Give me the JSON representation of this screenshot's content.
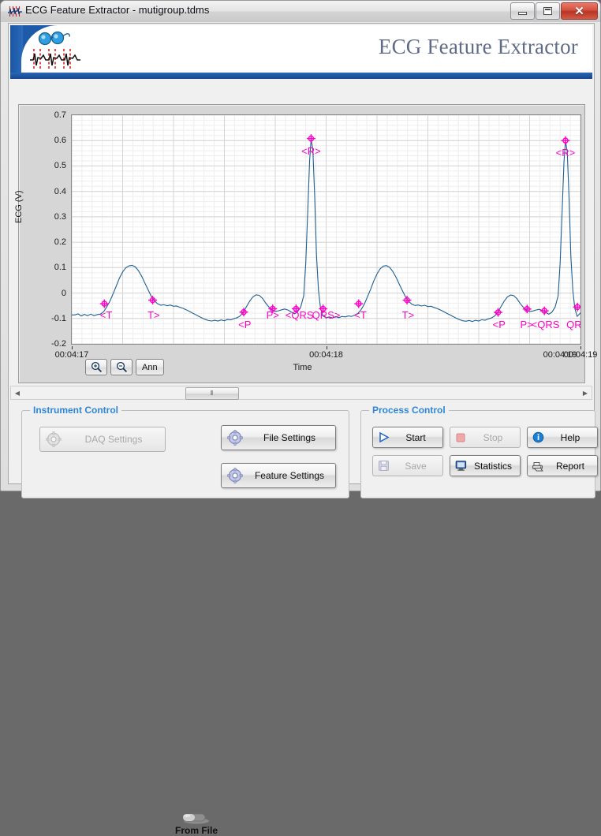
{
  "window": {
    "title": "ECG Feature Extractor - mutigroup.tdms",
    "icon": "ecg-waveform-icon",
    "buttons": {
      "minimize": "minimize-icon",
      "maximize": "maximize-icon",
      "close": "close-icon",
      "close_glyph": "✕"
    }
  },
  "banner": {
    "title": "ECG Feature Extractor",
    "logo": "ecg-glasses-logo"
  },
  "graph": {
    "y_axis_label": "ECG (V)",
    "x_axis_label": "Time",
    "y_ticks": [
      "0.7",
      "0.6",
      "0.5",
      "0.4",
      "0.3",
      "0.2",
      "0.1",
      "0",
      "-0.1",
      "-0.2"
    ],
    "x_ticks": [
      "00:04:17",
      "00:04:18",
      "00:04:19",
      "00:04:19"
    ],
    "buttons": [
      {
        "name": "zoom-in-button",
        "label": "",
        "icon": "zoom-in-icon"
      },
      {
        "name": "zoom-out-button",
        "label": "",
        "icon": "zoom-out-icon"
      },
      {
        "name": "annotation-button",
        "label": "Ann",
        "icon": ""
      }
    ]
  },
  "chart_data": {
    "type": "line",
    "title": "",
    "xlabel": "Time",
    "ylabel": "ECG (V)",
    "ylim": [
      -0.2,
      0.7
    ],
    "xlim": [
      0,
      2.0
    ],
    "x_tick_values": [
      0.0,
      1.0,
      2.0,
      2.0
    ],
    "x_tick_labels": [
      "00:04:17",
      "00:04:18",
      "00:04:19",
      "00:04:19"
    ],
    "grid": true,
    "legend": "none",
    "series_color": "#1f5f91",
    "annotation_color": "#ff00c8",
    "baseline": -0.085,
    "series": [
      {
        "name": "ECG",
        "points": [
          [
            0.0,
            -0.086
          ],
          [
            0.012,
            -0.086
          ],
          [
            0.025,
            -0.082
          ],
          [
            0.037,
            -0.09
          ],
          [
            0.05,
            -0.084
          ],
          [
            0.062,
            -0.089
          ],
          [
            0.075,
            -0.083
          ],
          [
            0.087,
            -0.089
          ],
          [
            0.1,
            -0.085
          ],
          [
            0.112,
            -0.083
          ],
          [
            0.125,
            -0.074
          ],
          [
            0.137,
            -0.055
          ],
          [
            0.15,
            -0.032
          ],
          [
            0.162,
            -0.004
          ],
          [
            0.175,
            0.028
          ],
          [
            0.187,
            0.058
          ],
          [
            0.2,
            0.083
          ],
          [
            0.212,
            0.099
          ],
          [
            0.225,
            0.107
          ],
          [
            0.237,
            0.109
          ],
          [
            0.25,
            0.103
          ],
          [
            0.262,
            0.088
          ],
          [
            0.275,
            0.066
          ],
          [
            0.287,
            0.04
          ],
          [
            0.3,
            0.013
          ],
          [
            0.312,
            -0.012
          ],
          [
            0.325,
            -0.03
          ],
          [
            0.337,
            -0.042
          ],
          [
            0.35,
            -0.048
          ],
          [
            0.362,
            -0.046
          ],
          [
            0.375,
            -0.05
          ],
          [
            0.387,
            -0.047
          ],
          [
            0.4,
            -0.052
          ],
          [
            0.412,
            -0.051
          ],
          [
            0.425,
            -0.056
          ],
          [
            0.437,
            -0.06
          ],
          [
            0.45,
            -0.066
          ],
          [
            0.462,
            -0.072
          ],
          [
            0.475,
            -0.079
          ],
          [
            0.487,
            -0.085
          ],
          [
            0.5,
            -0.092
          ],
          [
            0.512,
            -0.098
          ],
          [
            0.525,
            -0.104
          ],
          [
            0.537,
            -0.108
          ],
          [
            0.55,
            -0.11
          ],
          [
            0.562,
            -0.107
          ],
          [
            0.575,
            -0.11
          ],
          [
            0.587,
            -0.106
          ],
          [
            0.6,
            -0.109
          ],
          [
            0.612,
            -0.104
          ],
          [
            0.625,
            -0.106
          ],
          [
            0.637,
            -0.101
          ],
          [
            0.65,
            -0.097
          ],
          [
            0.662,
            -0.09
          ],
          [
            0.675,
            -0.075
          ],
          [
            0.687,
            -0.053
          ],
          [
            0.7,
            -0.031
          ],
          [
            0.712,
            -0.015
          ],
          [
            0.725,
            -0.007
          ],
          [
            0.737,
            -0.009
          ],
          [
            0.75,
            -0.021
          ],
          [
            0.762,
            -0.039
          ],
          [
            0.775,
            -0.055
          ],
          [
            0.787,
            -0.066
          ],
          [
            0.8,
            -0.072
          ],
          [
            0.812,
            -0.07
          ],
          [
            0.825,
            -0.066
          ],
          [
            0.837,
            -0.063
          ],
          [
            0.85,
            -0.067
          ],
          [
            0.862,
            -0.074
          ],
          [
            0.875,
            -0.082
          ],
          [
            0.887,
            -0.075
          ],
          [
            0.9,
            -0.055
          ],
          [
            0.912,
            -0.01
          ],
          [
            0.92,
            0.12
          ],
          [
            0.928,
            0.33
          ],
          [
            0.935,
            0.52
          ],
          [
            0.941,
            0.608
          ],
          [
            0.948,
            0.56
          ],
          [
            0.955,
            0.38
          ],
          [
            0.962,
            0.15
          ],
          [
            0.97,
            0.01
          ],
          [
            0.978,
            -0.06
          ],
          [
            0.987,
            -0.09
          ],
          [
            1.0,
            -0.097
          ],
          [
            1.012,
            -0.094
          ],
          [
            1.025,
            -0.098
          ],
          [
            1.037,
            -0.093
          ],
          [
            1.05,
            -0.097
          ],
          [
            1.062,
            -0.092
          ],
          [
            1.075,
            -0.094
          ],
          [
            1.087,
            -0.09
          ],
          [
            1.1,
            -0.092
          ],
          [
            1.112,
            -0.087
          ],
          [
            1.125,
            -0.08
          ],
          [
            1.137,
            -0.066
          ],
          [
            1.15,
            -0.044
          ],
          [
            1.162,
            -0.016
          ],
          [
            1.175,
            0.015
          ],
          [
            1.187,
            0.047
          ],
          [
            1.2,
            0.075
          ],
          [
            1.212,
            0.095
          ],
          [
            1.225,
            0.106
          ],
          [
            1.237,
            0.108
          ],
          [
            1.25,
            0.101
          ],
          [
            1.262,
            0.085
          ],
          [
            1.275,
            0.062
          ],
          [
            1.287,
            0.036
          ],
          [
            1.3,
            0.009
          ],
          [
            1.312,
            -0.015
          ],
          [
            1.325,
            -0.033
          ],
          [
            1.337,
            -0.044
          ],
          [
            1.35,
            -0.049
          ],
          [
            1.362,
            -0.047
          ],
          [
            1.375,
            -0.051
          ],
          [
            1.387,
            -0.048
          ],
          [
            1.4,
            -0.053
          ],
          [
            1.412,
            -0.052
          ],
          [
            1.425,
            -0.057
          ],
          [
            1.437,
            -0.061
          ],
          [
            1.45,
            -0.067
          ],
          [
            1.462,
            -0.073
          ],
          [
            1.475,
            -0.08
          ],
          [
            1.487,
            -0.086
          ],
          [
            1.5,
            -0.093
          ],
          [
            1.512,
            -0.099
          ],
          [
            1.525,
            -0.105
          ],
          [
            1.537,
            -0.109
          ],
          [
            1.55,
            -0.111
          ],
          [
            1.562,
            -0.108
          ],
          [
            1.575,
            -0.112
          ],
          [
            1.587,
            -0.107
          ],
          [
            1.6,
            -0.11
          ],
          [
            1.612,
            -0.105
          ],
          [
            1.625,
            -0.107
          ],
          [
            1.637,
            -0.102
          ],
          [
            1.65,
            -0.098
          ],
          [
            1.662,
            -0.091
          ],
          [
            1.675,
            -0.076
          ],
          [
            1.687,
            -0.054
          ],
          [
            1.7,
            -0.032
          ],
          [
            1.712,
            -0.016
          ],
          [
            1.725,
            -0.008
          ],
          [
            1.737,
            -0.01
          ],
          [
            1.75,
            -0.022
          ],
          [
            1.762,
            -0.04
          ],
          [
            1.775,
            -0.056
          ],
          [
            1.787,
            -0.067
          ],
          [
            1.8,
            -0.073
          ],
          [
            1.812,
            -0.071
          ],
          [
            1.825,
            -0.067
          ],
          [
            1.837,
            -0.064
          ],
          [
            1.85,
            -0.068
          ],
          [
            1.862,
            -0.075
          ],
          [
            1.875,
            -0.083
          ],
          [
            1.887,
            -0.076
          ],
          [
            1.9,
            -0.056
          ],
          [
            1.912,
            -0.011
          ],
          [
            1.92,
            0.118
          ],
          [
            1.928,
            0.328
          ],
          [
            1.935,
            0.515
          ],
          [
            1.941,
            0.6
          ],
          [
            1.948,
            0.555
          ],
          [
            1.955,
            0.375
          ],
          [
            1.962,
            0.148
          ],
          [
            1.97,
            0.008
          ],
          [
            1.978,
            -0.062
          ],
          [
            1.987,
            -0.092
          ],
          [
            2.0,
            -0.078
          ],
          [
            2.012,
            -0.07
          ],
          [
            2.025,
            -0.066
          ],
          [
            2.037,
            -0.071
          ],
          [
            2.05,
            -0.064
          ]
        ]
      }
    ],
    "annotations": [
      {
        "label": "<T",
        "x": 0.128,
        "y": -0.042,
        "tx": 0.135,
        "ty": -0.1
      },
      {
        "label": "T>",
        "x": 0.318,
        "y": -0.028,
        "tx": 0.322,
        "ty": -0.1
      },
      {
        "label": "<P",
        "x": 0.676,
        "y": -0.075,
        "tx": 0.68,
        "ty": -0.138
      },
      {
        "label": "P>",
        "x": 0.79,
        "y": -0.062,
        "tx": 0.79,
        "ty": -0.1
      },
      {
        "label": "<QRS",
        "x": 0.882,
        "y": -0.062,
        "tx": 0.895,
        "ty": -0.1
      },
      {
        "label": "<R>",
        "x": 0.941,
        "y": 0.608,
        "tx": 0.941,
        "ty": 0.545
      },
      {
        "label": "QRS>",
        "x": 0.988,
        "y": -0.062,
        "tx": 1.0,
        "ty": -0.1
      },
      {
        "label": "<T",
        "x": 1.128,
        "y": -0.042,
        "tx": 1.135,
        "ty": -0.1
      },
      {
        "label": "T>",
        "x": 1.318,
        "y": -0.028,
        "tx": 1.322,
        "ty": -0.1
      },
      {
        "label": "<P",
        "x": 1.676,
        "y": -0.076,
        "tx": 1.68,
        "ty": -0.138
      },
      {
        "label": "P>",
        "x": 1.79,
        "y": -0.063,
        "tx": 1.788,
        "ty": -0.138
      },
      {
        "label": "<QRS",
        "x": 1.858,
        "y": -0.07,
        "tx": 1.862,
        "ty": -0.138
      },
      {
        "label": "<R>",
        "x": 1.941,
        "y": 0.6,
        "tx": 1.941,
        "ty": 0.538
      },
      {
        "label": "QRS>",
        "x": 1.988,
        "y": -0.055,
        "tx": 2.0,
        "ty": -0.138
      }
    ]
  },
  "scrollbar": {
    "left_arrow": "scroll-left-icon",
    "right_arrow": "scroll-right-icon",
    "thumb_grip": "⦀"
  },
  "instrument_control": {
    "title": "Instrument Control",
    "daq_settings": {
      "label": "DAQ Settings",
      "icon": "gear-icon",
      "disabled": true
    },
    "toggle": {
      "label": "From File",
      "state": "from-file"
    },
    "file_settings": {
      "label": "File Settings",
      "icon": "gear-icon",
      "disabled": false
    },
    "feature_settings": {
      "label": "Feature Settings",
      "icon": "gear-icon",
      "disabled": false
    }
  },
  "process_control": {
    "title": "Process Control",
    "start": {
      "label": "Start",
      "icon": "play-icon",
      "disabled": false
    },
    "stop": {
      "label": "Stop",
      "icon": "stop-icon",
      "disabled": true
    },
    "help": {
      "label": "Help",
      "icon": "info-icon",
      "disabled": false
    },
    "save": {
      "label": "Save",
      "icon": "floppy-icon",
      "disabled": true
    },
    "statistics": {
      "label": "Statistics",
      "icon": "monitor-icon",
      "disabled": false
    },
    "report": {
      "label": "Report",
      "icon": "printer-icon",
      "disabled": false
    }
  },
  "colors": {
    "accent_blue": "#1d5aa8",
    "group_title": "#2f86d8",
    "trace": "#1f5f91",
    "annotation": "#ff00c8",
    "close_red": "#c0392b"
  }
}
